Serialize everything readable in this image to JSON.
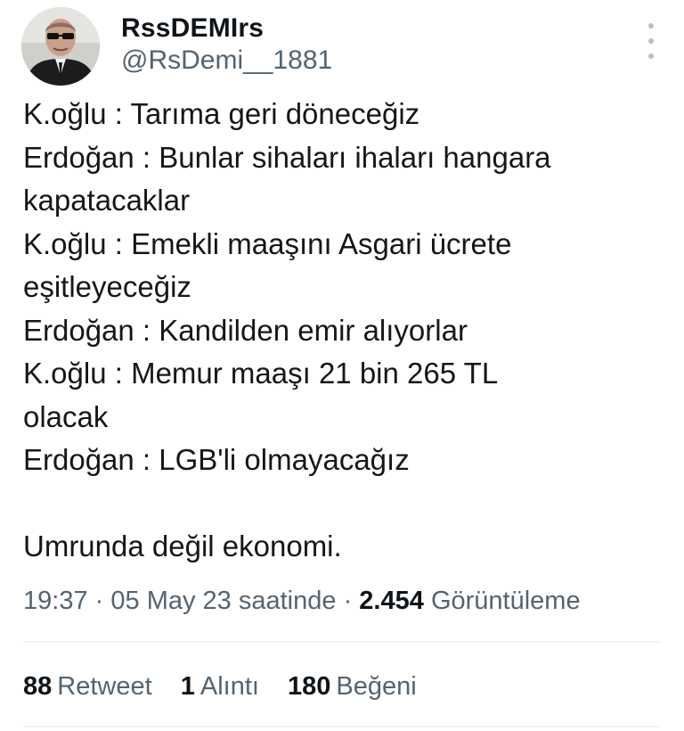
{
  "author": {
    "display_name": "RssDEMIrs",
    "handle": "@RsDemi__1881"
  },
  "tweet": {
    "lines": [
      "K.oğlu : Tarıma geri döneceğiz",
      "Erdoğan : Bunlar sihaları ihaları hangara",
      "kapatacaklar",
      "K.oğlu : Emekli maaşını Asgari ücrete",
      "eşitleyeceğiz",
      "Erdoğan : Kandilden emir alıyorlar",
      "K.oğlu : Memur maaşı 21 bin 265 TL",
      "olacak",
      "Erdoğan : LGB'li olmayacağız"
    ],
    "closing": "Umrunda değil ekonomi."
  },
  "meta": {
    "time": "19:37",
    "date": "05 May 23 saatinde",
    "separator": "·",
    "views_count": "2.454",
    "views_label": "Görüntüleme"
  },
  "stats": {
    "retweets_count": "88",
    "retweets_label": "Retweet",
    "quotes_count": "1",
    "quotes_label": "Alıntı",
    "likes_count": "180",
    "likes_label": "Beğeni"
  },
  "icons": {
    "more": "more-vertical-icon"
  },
  "colors": {
    "text": "#0f1419",
    "secondary": "#536471",
    "divider": "#eff3f4"
  }
}
